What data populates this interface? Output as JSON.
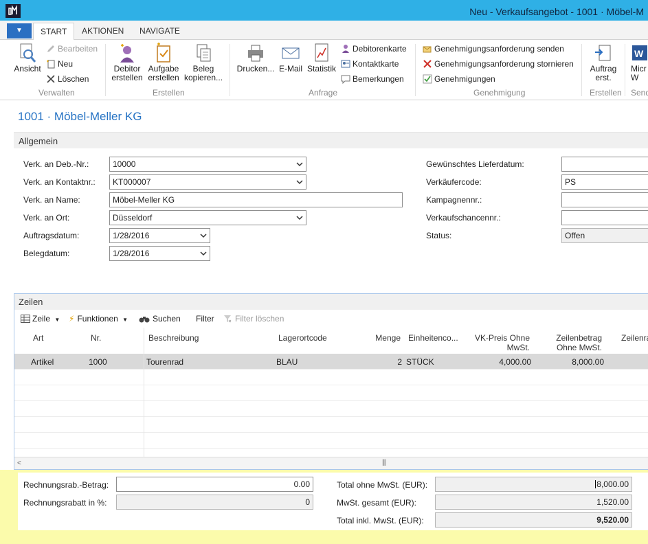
{
  "window": {
    "title": "Neu - Verkaufsangebot - 1001 · Möbel-M"
  },
  "ribbon": {
    "tabs": [
      {
        "label": "START"
      },
      {
        "label": "AKTIONEN"
      },
      {
        "label": "NAVIGATE"
      }
    ],
    "verwalten": {
      "ansicht": "Ansicht",
      "bearbeiten": "Bearbeiten",
      "neu": "Neu",
      "loeschen": "Löschen",
      "group": "Verwalten"
    },
    "erstellen": {
      "debitor": "Debitor\nerstellen",
      "aufgabe": "Aufgabe\nerstellen",
      "beleg": "Beleg\nkopieren...",
      "group": "Erstellen"
    },
    "anfrage": {
      "drucken": "Drucken...",
      "email": "E-Mail",
      "statistik": "Statistik",
      "debitorenkarte": "Debitorenkarte",
      "kontaktkarte": "Kontaktkarte",
      "bemerkungen": "Bemerkungen",
      "group": "Anfrage"
    },
    "genehmigung": {
      "senden": "Genehmigungsanforderung senden",
      "stornieren": "Genehmigungsanforderung stornieren",
      "genehmigungen": "Genehmigungen",
      "group": "Genehmigung"
    },
    "erstellen2": {
      "auftrag": "Auftrag\nerst.",
      "group": "Erstellen"
    },
    "send": {
      "micro": "Micr\nW",
      "group": "Send"
    }
  },
  "page": {
    "title": "1001 · Möbel-Meller KG"
  },
  "allgemein": {
    "title": "Allgemein",
    "fields": {
      "deb_nr": {
        "label": "Verk. an Deb.-Nr.:",
        "value": "10000"
      },
      "kontakt_nr": {
        "label": "Verk. an Kontaktnr.:",
        "value": "KT000007"
      },
      "name": {
        "label": "Verk. an Name:",
        "value": "Möbel-Meller KG"
      },
      "ort": {
        "label": "Verk. an Ort:",
        "value": "Düsseldorf"
      },
      "auftragsdatum": {
        "label": "Auftragsdatum:",
        "value": "1/28/2016"
      },
      "belegdatum": {
        "label": "Belegdatum:",
        "value": "1/28/2016"
      },
      "lieferdatum": {
        "label": "Gewünschtes Lieferdatum:",
        "value": ""
      },
      "verkaeufercode": {
        "label": "Verkäufercode:",
        "value": "PS"
      },
      "kampagnennr": {
        "label": "Kampagnennr.:",
        "value": ""
      },
      "verkaufschancennr": {
        "label": "Verkaufschancennr.:",
        "value": ""
      },
      "status": {
        "label": "Status:",
        "value": "Offen"
      }
    }
  },
  "zeilen": {
    "title": "Zeilen",
    "toolbar": {
      "zeile": "Zeile",
      "funktionen": "Funktionen",
      "suchen": "Suchen",
      "filter": "Filter",
      "filter_loeschen": "Filter löschen"
    },
    "columns": {
      "art": "Art",
      "nr": "Nr.",
      "beschreibung": "Beschreibung",
      "lagerortcode": "Lagerortcode",
      "menge": "Menge",
      "einheitencode": "Einheitenco...",
      "vk_preis_1": "VK-Preis Ohne",
      "vk_preis_2": "MwSt.",
      "zeilenbetrag_1": "Zeilenbetrag",
      "zeilenbetrag_2": "Ohne MwSt.",
      "zeilenrabatt": "Zeilenra"
    },
    "rows": [
      {
        "art": "Artikel",
        "nr": "1000",
        "beschreibung": "Tourenrad",
        "lagerortcode": "BLAU",
        "menge": "2",
        "einheit": "STÜCK",
        "vk_preis": "4,000.00",
        "zeilenbetrag": "8,000.00"
      }
    ]
  },
  "totals": {
    "rabatt_betrag": {
      "label": "Rechnungsrab.-Betrag:",
      "value": "0.00"
    },
    "rabatt_prozent": {
      "label": "Rechnungsrabatt in %:",
      "value": "0"
    },
    "ohne_mwst": {
      "label": "Total ohne MwSt. (EUR):",
      "value": "8,000.00"
    },
    "mwst": {
      "label": "MwSt. gesamt (EUR):",
      "value": "1,520.00"
    },
    "inkl_mwst": {
      "label": "Total inkl. MwSt. (EUR):",
      "value": "9,520.00"
    }
  },
  "colors": {
    "titlebar": "#2fb0e6",
    "accent": "#2673c4",
    "totals_bg": "#fbfbab",
    "selected_row": "#d9d9d9"
  }
}
